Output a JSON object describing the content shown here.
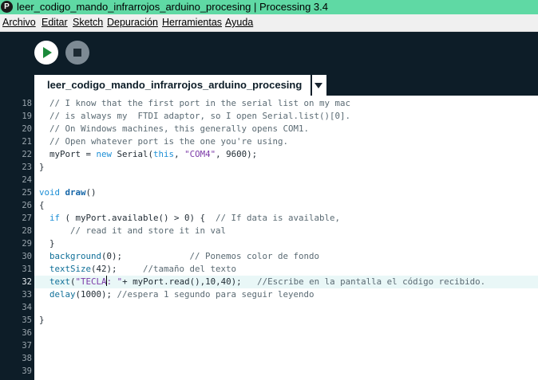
{
  "window": {
    "title": "leer_codigo_mando_infrarrojos_arduino_procesing | Processing 3.4",
    "icon": "processing-logo-icon"
  },
  "menu": [
    "Archivo",
    "Editar",
    "Sketch",
    "Depuración",
    "Herramientas",
    "Ayuda"
  ],
  "toolbar": {
    "run_icon": "play-icon",
    "stop_icon": "stop-icon"
  },
  "tab": {
    "label": "leer_codigo_mando_infrarrojos_arduino_procesing",
    "menu_icon": "chevron-down-icon"
  },
  "editor": {
    "current_line": 32,
    "line_numbers": [
      18,
      19,
      20,
      21,
      22,
      23,
      24,
      25,
      26,
      27,
      28,
      29,
      30,
      31,
      32,
      33,
      34,
      35,
      36,
      37,
      38,
      39
    ],
    "lines": [
      [
        {
          "t": "  // I know that the first port in the serial list on my mac",
          "c": "cm"
        }
      ],
      [
        {
          "t": "  // is always my  FTDI adaptor, so I open Serial.list()[0].",
          "c": "cm"
        }
      ],
      [
        {
          "t": "  // On Windows machines, this generally opens COM1.",
          "c": "cm"
        }
      ],
      [
        {
          "t": "  // Open whatever port is the one you're using.",
          "c": "cm"
        }
      ],
      [
        {
          "t": "  myPort = ",
          "c": ""
        },
        {
          "t": "new",
          "c": "kw"
        },
        {
          "t": " Serial(",
          "c": ""
        },
        {
          "t": "this",
          "c": "kw"
        },
        {
          "t": ", ",
          "c": ""
        },
        {
          "t": "\"COM4\"",
          "c": "st"
        },
        {
          "t": ", 9600);",
          "c": ""
        }
      ],
      [
        {
          "t": "}",
          "c": ""
        }
      ],
      [],
      [
        {
          "t": "void",
          "c": "kw"
        },
        {
          "t": " ",
          "c": ""
        },
        {
          "t": "draw",
          "c": "fnb"
        },
        {
          "t": "()",
          "c": ""
        }
      ],
      [
        {
          "t": "{",
          "c": ""
        }
      ],
      [
        {
          "t": "  ",
          "c": ""
        },
        {
          "t": "if",
          "c": "kw"
        },
        {
          "t": " ( myPort.available() > 0) {  ",
          "c": ""
        },
        {
          "t": "// If data is available,",
          "c": "cm"
        }
      ],
      [
        {
          "t": "      ",
          "c": ""
        },
        {
          "t": "// read it and store it in val",
          "c": "cm"
        }
      ],
      [
        {
          "t": "  }",
          "c": ""
        }
      ],
      [
        {
          "t": "  ",
          "c": ""
        },
        {
          "t": "background",
          "c": "fn"
        },
        {
          "t": "(0);             ",
          "c": ""
        },
        {
          "t": "// Ponemos color de fondo",
          "c": "cm"
        }
      ],
      [
        {
          "t": "  ",
          "c": ""
        },
        {
          "t": "textSize",
          "c": "fn"
        },
        {
          "t": "(42);     ",
          "c": ""
        },
        {
          "t": "//tamaño del texto",
          "c": "cm"
        }
      ],
      [
        {
          "t": "  ",
          "c": ""
        },
        {
          "t": "text",
          "c": "fn"
        },
        {
          "t": "(",
          "c": ""
        },
        {
          "t": "\"TECLA",
          "c": "st"
        },
        {
          "t": "|",
          "c": "caret"
        },
        {
          "t": ": \"",
          "c": "st"
        },
        {
          "t": "+ myPort.read(),10,40);   ",
          "c": ""
        },
        {
          "t": "//Escribe en la pantalla el código recibido.",
          "c": "cm"
        }
      ],
      [
        {
          "t": "  ",
          "c": ""
        },
        {
          "t": "delay",
          "c": "fn"
        },
        {
          "t": "(1000); ",
          "c": ""
        },
        {
          "t": "//espera 1 segundo para seguir leyendo",
          "c": "cm"
        }
      ],
      [],
      [
        {
          "t": "}",
          "c": ""
        }
      ],
      [],
      [],
      [],
      []
    ]
  }
}
